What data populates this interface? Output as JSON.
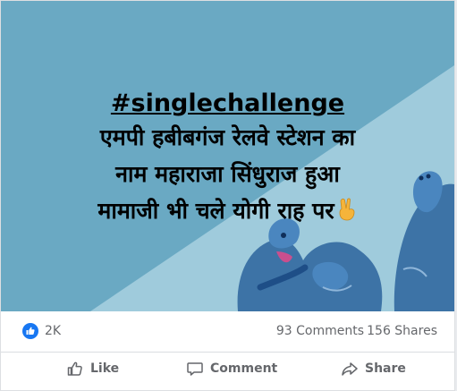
{
  "post": {
    "hashtag": "#singlechallenge",
    "headline_lines": [
      "एमपी हबीबगंज रेलवे स्टेशन का",
      "नाम महाराजा सिंधुराज हुआ",
      "मामाजी भी चले योगी राह पर"
    ],
    "emoji": "victory-hand-emoji",
    "colors": {
      "banner_bg": "#6aa9c3",
      "banner_light": "#9fcbdc",
      "accent": "#1877f2"
    }
  },
  "stats": {
    "reactions_count": "2K",
    "comments": "93 Comments",
    "shares": "156 Shares"
  },
  "actions": {
    "like": "Like",
    "comment": "Comment",
    "share": "Share"
  }
}
